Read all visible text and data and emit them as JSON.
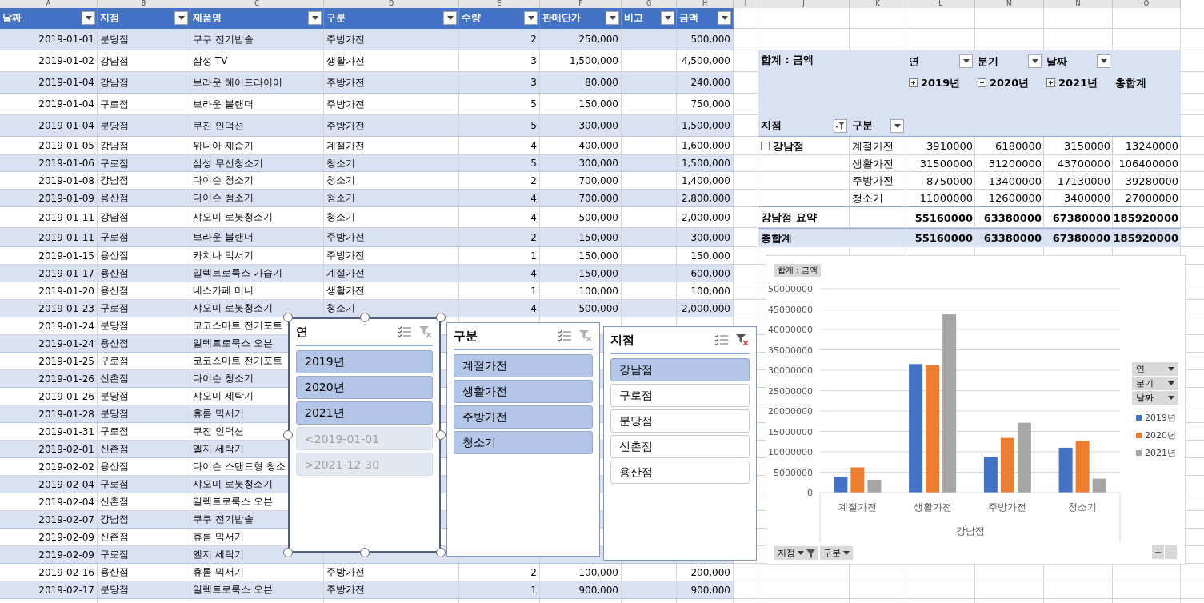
{
  "column_letters": [
    "A",
    "B",
    "C",
    "D",
    "E",
    "F",
    "G",
    "H",
    "I",
    "J",
    "K",
    "L",
    "M",
    "N",
    "O"
  ],
  "table": {
    "columns": [
      "날짜",
      "지점",
      "제품명",
      "구분",
      "수량",
      "판매단가",
      "비고",
      "금액"
    ],
    "rows": [
      {
        "date": "2019-01-01",
        "branch": "분당점",
        "product": "쿠쿠 전기밥솥",
        "category": "주방가전",
        "qty": "2",
        "price": "250,000",
        "amount": "500,000"
      },
      {
        "date": "2019-01-02",
        "branch": "강남점",
        "product": "삼성 TV",
        "category": "생활가전",
        "qty": "3",
        "price": "1,500,000",
        "amount": "4,500,000"
      },
      {
        "date": "2019-01-04",
        "branch": "강남점",
        "product": "브라운 헤어드라이어",
        "category": "주방가전",
        "qty": "3",
        "price": "80,000",
        "amount": "240,000"
      },
      {
        "date": "2019-01-04",
        "branch": "구로점",
        "product": "브라운 블랜더",
        "category": "주방가전",
        "qty": "5",
        "price": "150,000",
        "amount": "750,000"
      },
      {
        "date": "2019-01-04",
        "branch": "분당점",
        "product": "쿠진 인덕션",
        "category": "주방가전",
        "qty": "5",
        "price": "300,000",
        "amount": "1,500,000"
      },
      {
        "date": "2019-01-05",
        "branch": "강남점",
        "product": "위니아 제습기",
        "category": "계절가전",
        "qty": "4",
        "price": "400,000",
        "amount": "1,600,000"
      },
      {
        "date": "2019-01-06",
        "branch": "구로점",
        "product": "삼성 무선청소기",
        "category": "청소기",
        "qty": "5",
        "price": "300,000",
        "amount": "1,500,000"
      },
      {
        "date": "2019-01-08",
        "branch": "강남점",
        "product": "다이슨 청소기",
        "category": "청소기",
        "qty": "2",
        "price": "700,000",
        "amount": "1,400,000"
      },
      {
        "date": "2019-01-09",
        "branch": "용산점",
        "product": "다이슨 청소기",
        "category": "청소기",
        "qty": "4",
        "price": "700,000",
        "amount": "2,800,000"
      },
      {
        "date": "2019-01-11",
        "branch": "강남점",
        "product": "샤오미 로봇청소기",
        "category": "청소기",
        "qty": "4",
        "price": "500,000",
        "amount": "2,000,000"
      },
      {
        "date": "2019-01-11",
        "branch": "구로점",
        "product": "브라운 블랜더",
        "category": "주방가전",
        "qty": "2",
        "price": "150,000",
        "amount": "300,000"
      },
      {
        "date": "2019-01-15",
        "branch": "용산점",
        "product": "카치나 믹서기",
        "category": "주방가전",
        "qty": "1",
        "price": "150,000",
        "amount": "150,000"
      },
      {
        "date": "2019-01-17",
        "branch": "용산점",
        "product": "일렉트로룩스 가습기",
        "category": "계절가전",
        "qty": "4",
        "price": "150,000",
        "amount": "600,000"
      },
      {
        "date": "2019-01-20",
        "branch": "용산점",
        "product": "네스카페 미니",
        "category": "생활가전",
        "qty": "1",
        "price": "100,000",
        "amount": "100,000"
      },
      {
        "date": "2019-01-23",
        "branch": "구로점",
        "product": "샤오미 로봇청소기",
        "category": "청소기",
        "qty": "4",
        "price": "500,000",
        "amount": "2,000,000"
      },
      {
        "date": "2019-01-24",
        "branch": "분당점",
        "product": "코코스마트 전기포트"
      },
      {
        "date": "2019-01-24",
        "branch": "용산점",
        "product": "일렉트로룩스 오븐"
      },
      {
        "date": "2019-01-25",
        "branch": "구로점",
        "product": "코코스마트 전기포트"
      },
      {
        "date": "2019-01-26",
        "branch": "신촌점",
        "product": "다이슨 청소기"
      },
      {
        "date": "2019-01-26",
        "branch": "분당점",
        "product": "샤오미 세탁기"
      },
      {
        "date": "2019-01-28",
        "branch": "분당점",
        "product": "휴롬 믹서기"
      },
      {
        "date": "2019-01-31",
        "branch": "구로점",
        "product": "쿠진 인덕션"
      },
      {
        "date": "2019-02-01",
        "branch": "신촌점",
        "product": "엘지 세탁기"
      },
      {
        "date": "2019-02-02",
        "branch": "용산점",
        "product": "다이슨 스탠드형 청소"
      },
      {
        "date": "2019-02-04",
        "branch": "구로점",
        "product": "샤오미 로봇청소기"
      },
      {
        "date": "2019-02-04",
        "branch": "신촌점",
        "product": "일렉트로룩스 오븐"
      },
      {
        "date": "2019-02-07",
        "branch": "강남점",
        "product": "쿠쿠 전기밥솥"
      },
      {
        "date": "2019-02-09",
        "branch": "신촌점",
        "product": "휴롬 믹서기"
      },
      {
        "date": "2019-02-09",
        "branch": "구로점",
        "product": "엘지 세탁기"
      },
      {
        "date": "2019-02-16",
        "branch": "용산점",
        "product": "휴롬 믹서기",
        "category": "주방가전",
        "qty": "2",
        "price": "100,000",
        "amount": "200,000"
      },
      {
        "date": "2019-02-17",
        "branch": "분당점",
        "product": "일렉트로룩스 오븐",
        "category": "주방가전",
        "qty": "1",
        "price": "900,000",
        "amount": "900,000"
      }
    ]
  },
  "pivot": {
    "value_field": "합계 : 금액",
    "column_fields": [
      "연",
      "분기",
      "날짜"
    ],
    "column_items": [
      {
        "label": "2019년",
        "expanded": false
      },
      {
        "label": "2020년",
        "expanded": false
      },
      {
        "label": "2021년",
        "expanded": false
      }
    ],
    "grand_total_label": "총합계",
    "row_fields": [
      {
        "label": "지점",
        "filtered": true
      },
      {
        "label": "구분",
        "filtered": false
      }
    ],
    "row_groups": [
      {
        "label": "강남점",
        "expanded": true,
        "rows": [
          {
            "label": "계절가전",
            "values": [
              "3910000",
              "6180000",
              "3150000",
              "13240000"
            ]
          },
          {
            "label": "생활가전",
            "values": [
              "31500000",
              "31200000",
              "43700000",
              "106400000"
            ]
          },
          {
            "label": "주방가전",
            "values": [
              "8750000",
              "13400000",
              "17130000",
              "39280000"
            ]
          },
          {
            "label": "청소기",
            "values": [
              "11000000",
              "12600000",
              "3400000",
              "27000000"
            ]
          }
        ],
        "subtotal_label": "강남점 요약",
        "subtotal_values": [
          "55160000",
          "63380000",
          "67380000",
          "185920000"
        ]
      }
    ],
    "grand_total_row": {
      "label": "총합계",
      "values": [
        "55160000",
        "63380000",
        "67380000",
        "185920000"
      ]
    }
  },
  "slicers": [
    {
      "title": "연",
      "selected": true,
      "filtered": false,
      "items": [
        {
          "label": "2019년",
          "selected": true,
          "disabled": false
        },
        {
          "label": "2020년",
          "selected": true,
          "disabled": false
        },
        {
          "label": "2021년",
          "selected": true,
          "disabled": false
        },
        {
          "label": "<2019-01-01",
          "selected": false,
          "disabled": true
        },
        {
          "label": ">2021-12-30",
          "selected": false,
          "disabled": true
        }
      ]
    },
    {
      "title": "구분",
      "selected": false,
      "filtered": false,
      "items": [
        {
          "label": "계절가전",
          "selected": true,
          "disabled": false
        },
        {
          "label": "생활가전",
          "selected": true,
          "disabled": false
        },
        {
          "label": "주방가전",
          "selected": true,
          "disabled": false
        },
        {
          "label": "청소기",
          "selected": true,
          "disabled": false
        }
      ]
    },
    {
      "title": "지점",
      "selected": false,
      "filtered": true,
      "items": [
        {
          "label": "강남점",
          "selected": true,
          "disabled": false
        },
        {
          "label": "구로점",
          "selected": false,
          "disabled": false
        },
        {
          "label": "분당점",
          "selected": false,
          "disabled": false
        },
        {
          "label": "신촌점",
          "selected": false,
          "disabled": false
        },
        {
          "label": "용산점",
          "selected": false,
          "disabled": false
        }
      ]
    }
  ],
  "pivot_chart": {
    "value_button": "합계 : 금액",
    "legend_buttons": [
      "연",
      "분기",
      "날짜"
    ],
    "axis_buttons": [
      {
        "label": "지점",
        "filtered": true
      },
      {
        "label": "구분",
        "filtered": false
      }
    ],
    "zoom_buttons": [
      "+",
      "−"
    ],
    "chart_data": {
      "type": "bar",
      "categories": [
        "계절가전",
        "생활가전",
        "주방가전",
        "청소기"
      ],
      "xlabel": "강남점",
      "series": [
        {
          "name": "2019년",
          "color": "#4472c4",
          "values": [
            3910000,
            31500000,
            8750000,
            11000000
          ]
        },
        {
          "name": "2020년",
          "color": "#ed7d31",
          "values": [
            6180000,
            31200000,
            13400000,
            12600000
          ]
        },
        {
          "name": "2021년",
          "color": "#a5a5a5",
          "values": [
            3150000,
            43700000,
            17130000,
            3400000
          ]
        }
      ],
      "grid": true,
      "ylim": [
        0,
        50000000
      ],
      "yticks": [
        0,
        5000000,
        10000000,
        15000000,
        20000000,
        25000000,
        30000000,
        35000000,
        40000000,
        45000000,
        50000000
      ]
    }
  }
}
